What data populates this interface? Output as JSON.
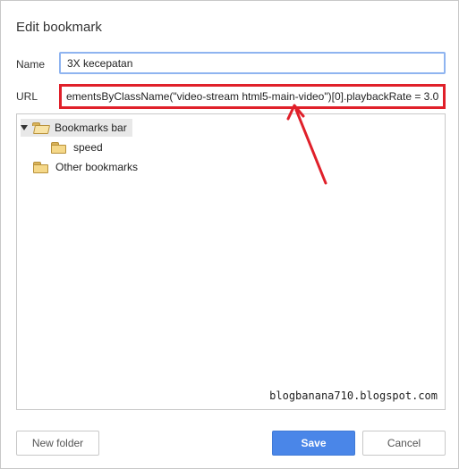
{
  "dialog": {
    "title": "Edit bookmark",
    "name_label": "Name",
    "name_value": "3X kecepatan",
    "url_label": "URL",
    "url_value": "ementsByClassName(\"video-stream html5-main-video\")[0].playbackRate = 3.0;"
  },
  "tree": {
    "items": [
      {
        "label": "Bookmarks bar",
        "expanded": true,
        "selected": true,
        "icon": "folder-open-icon"
      },
      {
        "label": "speed",
        "icon": "folder-icon"
      },
      {
        "label": "Other bookmarks",
        "icon": "folder-icon"
      }
    ],
    "watermark": "blogbanana710.blogspot.com"
  },
  "buttons": {
    "new_folder": "New folder",
    "save": "Save",
    "cancel": "Cancel"
  },
  "colors": {
    "accent": "#4a86e8",
    "highlight": "#e0202a"
  }
}
